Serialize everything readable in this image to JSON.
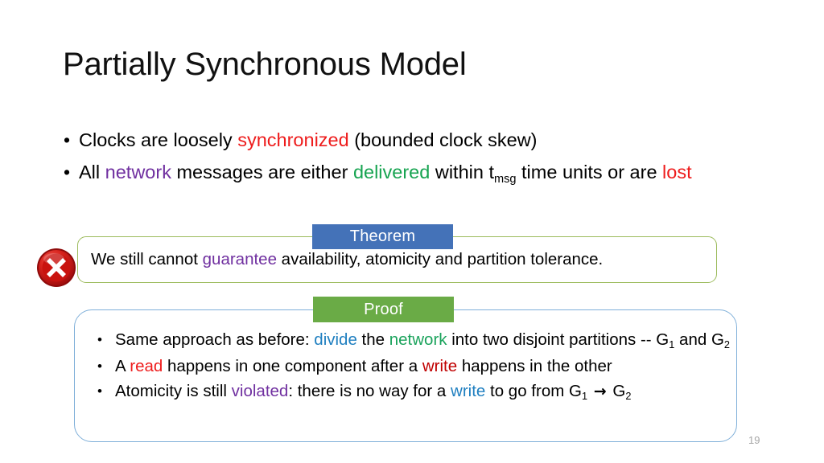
{
  "slide": {
    "title": "Partially Synchronous Model",
    "page_number": "19"
  },
  "bullets": [
    {
      "marker": "•",
      "segments": [
        {
          "text": "Clocks are loosely ",
          "color": "black"
        },
        {
          "text": "synchronized",
          "color": "#EE1C1C"
        },
        {
          "text": " (bounded clock skew)",
          "color": "black"
        }
      ],
      "plain": "Clocks are loosely synchronized (bounded clock skew)"
    },
    {
      "marker": "•",
      "segments": [
        {
          "text": "All ",
          "color": "black"
        },
        {
          "text": "network",
          "color": "#7030A0"
        },
        {
          "text": " messages are either ",
          "color": "black"
        },
        {
          "text": "delivered",
          "color": "#17A451"
        },
        {
          "text": " within t",
          "color": "black"
        },
        {
          "text": "msg",
          "color": "black",
          "subscript": true
        },
        {
          "text": " time units or are ",
          "color": "black"
        },
        {
          "text": "lost",
          "color": "#EE1C1C"
        }
      ],
      "plain": "All network messages are either delivered within tmsg time units or are lost"
    }
  ],
  "theorem": {
    "label": "Theorem",
    "label_bg": "#4472B8",
    "label_color": "#FFFFFF",
    "border_color": "#9CBB5C",
    "icon": "error-x-icon",
    "segments": [
      {
        "text": "We still cannot ",
        "color": "black"
      },
      {
        "text": "guarantee",
        "color": "#7030A0"
      },
      {
        "text": " availability, atomicity and partition tolerance.",
        "color": "black"
      }
    ],
    "plain": "We still cannot guarantee availability, atomicity and partition tolerance."
  },
  "proof": {
    "label": "Proof",
    "label_bg": "#6AAB46",
    "label_color": "#FFFFFF",
    "border_color": "#7FAFD9",
    "bullets": [
      {
        "marker": "•",
        "segments": [
          {
            "text": "Same approach as before: ",
            "color": "black"
          },
          {
            "text": "divide",
            "color": "#1F7FC0"
          },
          {
            "text": " the ",
            "color": "black"
          },
          {
            "text": "network",
            "color": "#1BA35C"
          },
          {
            "text": " into two disjoint partitions -- G",
            "color": "black"
          },
          {
            "text": "1",
            "color": "black",
            "subscript": true
          },
          {
            "text": " and G",
            "color": "black"
          },
          {
            "text": "2",
            "color": "black",
            "subscript": true
          }
        ],
        "plain": "Same approach as before: divide the network into two disjoint partitions -- G1 and G2"
      },
      {
        "marker": "•",
        "segments": [
          {
            "text": "A ",
            "color": "black"
          },
          {
            "text": "read",
            "color": "#EE1C1C"
          },
          {
            "text": " happens in one component after a ",
            "color": "black"
          },
          {
            "text": "write",
            "color": "#C00000"
          },
          {
            "text": " happens in the other",
            "color": "black"
          }
        ],
        "plain": "A read happens in one component after a write happens in the other"
      },
      {
        "marker": "•",
        "segments": [
          {
            "text": "Atomicity is still ",
            "color": "black"
          },
          {
            "text": "violated",
            "color": "#7030A0"
          },
          {
            "text": ": there is no way for a ",
            "color": "black"
          },
          {
            "text": "write",
            "color": "#1F7FC0"
          },
          {
            "text": " to go from G",
            "color": "black"
          },
          {
            "text": "1",
            "color": "black",
            "subscript": true
          },
          {
            "text": " ",
            "color": "black"
          },
          {
            "text": "→",
            "color": "black",
            "arrow": true
          },
          {
            "text": " G",
            "color": "black"
          },
          {
            "text": "2",
            "color": "black",
            "subscript": true
          }
        ],
        "plain": "Atomicity is still violated: there is no way for a write to go from G1 → G2"
      }
    ]
  }
}
